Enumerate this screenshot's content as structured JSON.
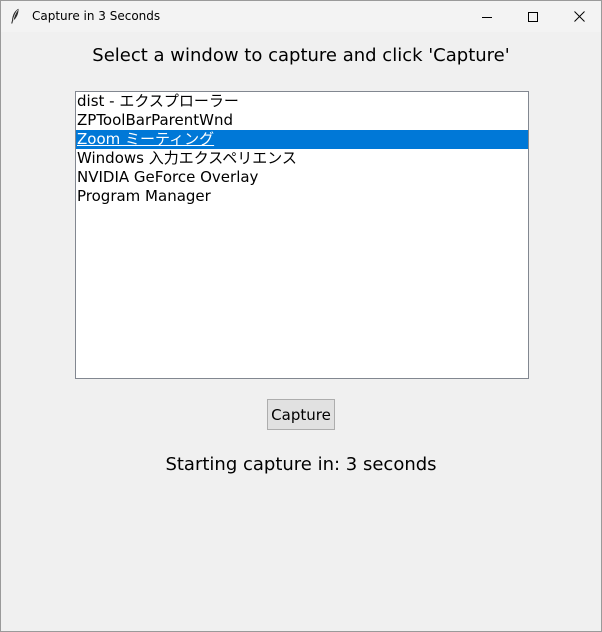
{
  "window": {
    "title": "Capture in 3 Seconds"
  },
  "prompt": "Select a window to capture and click 'Capture'",
  "window_list": {
    "items": [
      {
        "label": "dist - エクスプローラー",
        "selected": false
      },
      {
        "label": "ZPToolBarParentWnd",
        "selected": false
      },
      {
        "label": "Zoom ミーティング",
        "selected": true
      },
      {
        "label": "Windows 入力エクスペリエンス",
        "selected": false
      },
      {
        "label": "NVIDIA GeForce Overlay",
        "selected": false
      },
      {
        "label": "Program Manager",
        "selected": false
      }
    ]
  },
  "capture_button": {
    "label": "Capture"
  },
  "status": "Starting capture in: 3 seconds",
  "icons": {
    "app": "feather-icon",
    "minimize": "minimize-icon",
    "maximize": "maximize-icon",
    "close": "close-icon"
  },
  "colors": {
    "selection": "#0078d7",
    "window_bg": "#f0f0f0"
  }
}
